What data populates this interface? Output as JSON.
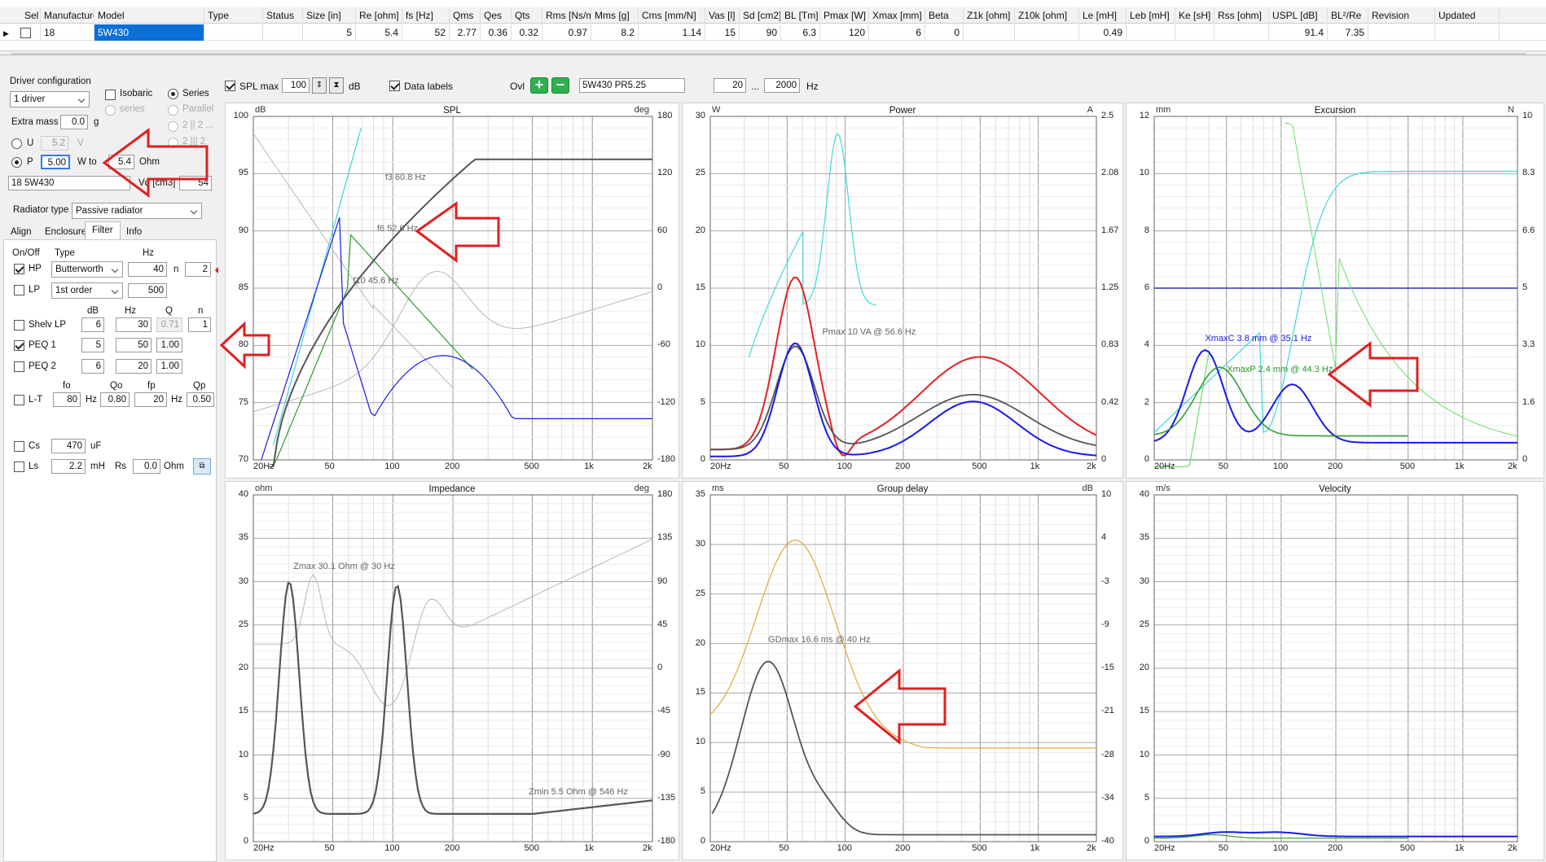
{
  "grid": {
    "columns": [
      "Sel",
      "Manufacturer",
      "Model",
      "Type",
      "Status",
      "Size [in]",
      "Re [ohm]",
      "fs [Hz]",
      "Qms",
      "Qes",
      "Qts",
      "Rms [Ns/m]",
      "Mms [g]",
      "Cms [mm/N]",
      "Vas [l]",
      "Sd [cm2]",
      "BL [Tm]",
      "Pmax [W]",
      "Xmax [mm]",
      "Beta",
      "Z1k [ohm]",
      "Z10k [ohm]",
      "Le [mH]",
      "Leb [mH]",
      "Ke [sH]",
      "Rss [ohm]",
      "USPL [dB]",
      "BL²/Re",
      "Revision",
      "Updated"
    ],
    "row": [
      "",
      "18",
      "5W430",
      "",
      "",
      "5",
      "5.4",
      "52",
      "2.77",
      "0.36",
      "0.32",
      "0.97",
      "8.2",
      "1.14",
      "15",
      "90",
      "6.3",
      "120",
      "6",
      "0",
      "",
      "",
      "0.49",
      "",
      "",
      "",
      "91.4",
      "7.35",
      "",
      ""
    ]
  },
  "config": {
    "title": "Driver configuration",
    "drivers": "1 driver",
    "isobaric": "Isobaric",
    "series_opt": "Series",
    "series_sub": "series",
    "parallel": "Parallel",
    "opt_2": "2 || 2 ...",
    "opt_3": "2 ||| 2",
    "extra_mass_label": "Extra mass",
    "extra_mass": "0.0",
    "g": "g",
    "u_label": "U",
    "u_value": "5.2",
    "v": "V",
    "p_label": "P",
    "p_value": "5.00",
    "w_to": "W to",
    "ohm_value": "5.4",
    "ohm": "Ohm",
    "driver_name": "18 5W430",
    "vd_label": "Vd [cm3]",
    "vd_value": "54",
    "radiator_label": "Radiator type",
    "radiator": "Passive radiator"
  },
  "tabs": [
    "Align",
    "Enclosure",
    "Filter",
    "Info"
  ],
  "filter": {
    "on_off": "On/Off",
    "type": "Type",
    "hz": "Hz",
    "hp": "HP",
    "hp_type": "Butterworth",
    "hp_hz": "40",
    "n": "n",
    "hp_n": "2",
    "lp": "LP",
    "lp_type": "1st order",
    "lp_hz": "500",
    "db": "dB",
    "q": "Q",
    "shelv": "Shelv LP",
    "shelv_db": "6",
    "shelv_hz": "30",
    "shelv_q": "0.71",
    "shelv_n": "1",
    "peq1": "PEQ 1",
    "peq1_db": "5",
    "peq1_hz": "50",
    "peq1_q": "1.00",
    "peq2": "PEQ 2",
    "peq2_db": "6",
    "peq2_hz": "20",
    "peq2_q": "1.00",
    "fo": "fo",
    "qo": "Qo",
    "fp": "fp",
    "qp": "Qp",
    "lt": "L-T",
    "lt_fo": "80",
    "lt_qo": "0.80",
    "lt_fp": "20",
    "lt_qp": "0.50",
    "cs": "Cs",
    "cs_val": "470",
    "uf": "uF",
    "ls": "Ls",
    "ls_val": "2.2",
    "mh": "mH",
    "rs": "Rs",
    "rs_val": "0.0"
  },
  "toolbar": {
    "spl_max": "SPL max",
    "spl_value": "100",
    "db": "dB",
    "data_labels": "Data labels",
    "ovl": "Ovl",
    "overlay_name": "5W430 PR5.25",
    "f_low": "20",
    "dots": "...",
    "f_high": "2000",
    "hz": "Hz"
  },
  "x_ticks": [
    "20Hz",
    "50",
    "100",
    "200",
    "500",
    "1k",
    "2k"
  ],
  "panels": {
    "spl": {
      "title": "SPL",
      "unitL": "dB",
      "unitR": "deg",
      "yL": [
        "100",
        "95",
        "90",
        "85",
        "80",
        "75",
        "70"
      ],
      "yR": [
        "180",
        "120",
        "60",
        "0",
        "-60",
        "-120",
        "-180"
      ],
      "labels": [
        "f3 60.8 Hz",
        "f6 52.6 Hz",
        "f10 45.6 Hz"
      ]
    },
    "power": {
      "title": "Power",
      "unitL": "W",
      "unitR": "A",
      "yL": [
        "30",
        "25",
        "20",
        "15",
        "10",
        "5",
        "0"
      ],
      "yR": [
        "2.5",
        "2.08",
        "1.67",
        "1.25",
        "0.83",
        "0.42",
        "0"
      ],
      "labels": [
        "Pmax 10 VA  @ 56.6 Hz"
      ]
    },
    "excursion": {
      "title": "Excursion",
      "unitL": "mm",
      "unitR": "N",
      "yL": [
        "12",
        "10",
        "8",
        "6",
        "4",
        "2",
        "0"
      ],
      "yR": [
        "10",
        "8.3",
        "6.6",
        "5",
        "3.3",
        "1.6",
        "0"
      ],
      "labels": [
        "XmaxC 3.8 mm  @ 35.1 Hz",
        "XmaxP 2.4 mm  @ 44.3 Hz"
      ]
    },
    "impedance": {
      "title": "Impedance",
      "unitL": "ohm",
      "unitR": "deg",
      "yL": [
        "40",
        "35",
        "30",
        "25",
        "20",
        "15",
        "10",
        "5",
        "0"
      ],
      "yR": [
        "180",
        "135",
        "90",
        "45",
        "0",
        "-45",
        "-90",
        "-135",
        "-180"
      ],
      "labels": [
        "Zmax 30.1 Ohm @ 30 Hz",
        "Zmin 5.5 Ohm @ 546 Hz"
      ]
    },
    "gd": {
      "title": "Group delay",
      "unitL": "ms",
      "unitR": "dB",
      "yL": [
        "35",
        "30",
        "25",
        "20",
        "15",
        "10",
        "5",
        "0"
      ],
      "yR": [
        "10",
        "4",
        "-3",
        "-9",
        "-15",
        "-21",
        "-28",
        "-34",
        "-40"
      ],
      "labels": [
        "GDmax 16.6 ms  @ 40 Hz"
      ]
    },
    "velocity": {
      "title": "Velocity",
      "unitL": "m/s",
      "unitR": "",
      "yL": [
        "40",
        "35",
        "30",
        "25",
        "20",
        "15",
        "10",
        "5",
        "0"
      ],
      "yR": [],
      "labels": []
    }
  },
  "colors": {
    "dark": "#555555",
    "blue": "#1a1ae6",
    "green": "#2e9a2e",
    "cyan": "#40d8d8",
    "red": "#e82020",
    "orange": "#e6a63a",
    "light": "#b8b8b8",
    "lightgreen": "#66e266",
    "navy": "#3030c0",
    "arrow": "#e02020"
  }
}
